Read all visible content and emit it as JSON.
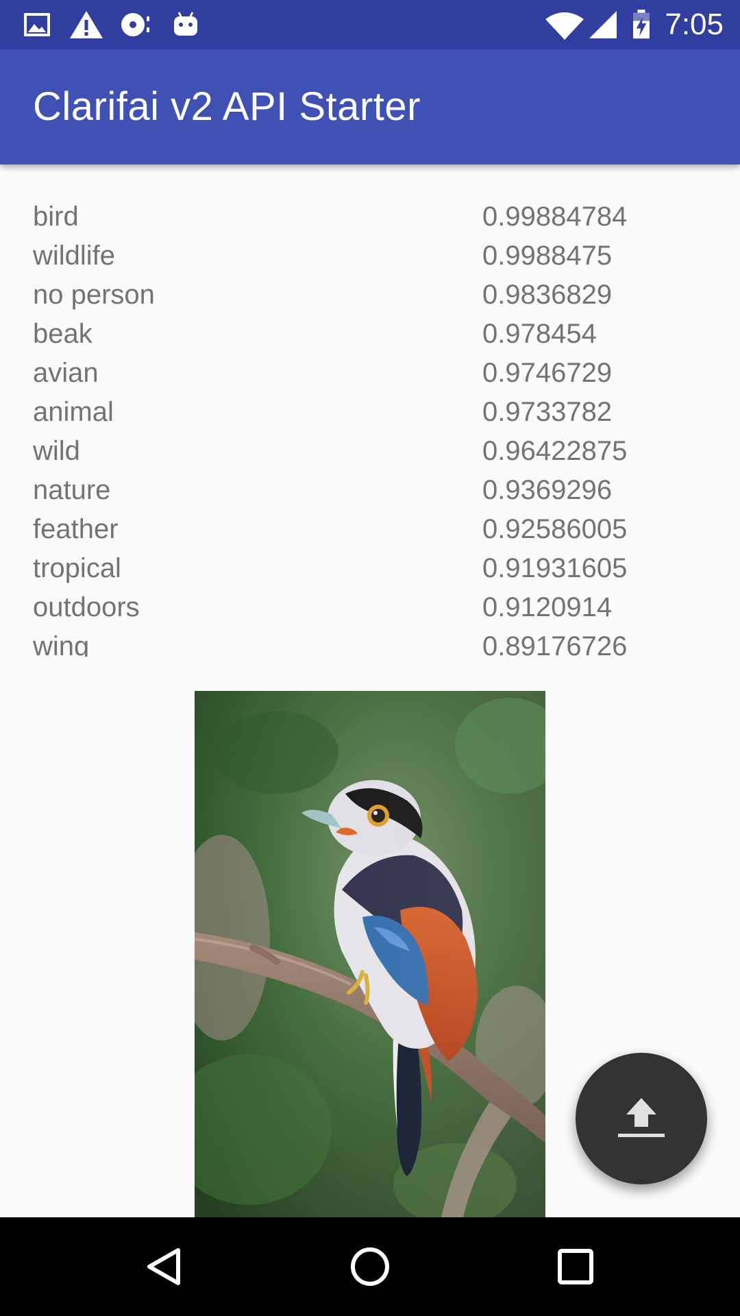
{
  "status_bar": {
    "time": "7:05",
    "left_icons": [
      "image-icon",
      "warning-icon",
      "disc-icon",
      "android-icon"
    ],
    "right_icons": [
      "wifi-icon",
      "signal-icon",
      "battery-charging-icon"
    ]
  },
  "app_bar": {
    "title": "Clarifai v2 API Starter",
    "color": "#3f51b5"
  },
  "tags": [
    {
      "name": "bird",
      "value": "0.99884784"
    },
    {
      "name": "wildlife",
      "value": "0.9988475"
    },
    {
      "name": "no person",
      "value": "0.9836829"
    },
    {
      "name": "beak",
      "value": "0.978454"
    },
    {
      "name": "avian",
      "value": "0.9746729"
    },
    {
      "name": "animal",
      "value": "0.9733782"
    },
    {
      "name": "wild",
      "value": "0.96422875"
    },
    {
      "name": "nature",
      "value": "0.9369296"
    },
    {
      "name": "feather",
      "value": "0.92586005"
    },
    {
      "name": "tropical",
      "value": "0.91931605"
    },
    {
      "name": "outdoors",
      "value": "0.9120914"
    },
    {
      "name": "wing",
      "value": "0.89176726"
    }
  ],
  "fab": {
    "icon": "upload-icon"
  },
  "nav_bar": {
    "icons": [
      "back-icon",
      "home-icon",
      "recents-icon"
    ]
  }
}
